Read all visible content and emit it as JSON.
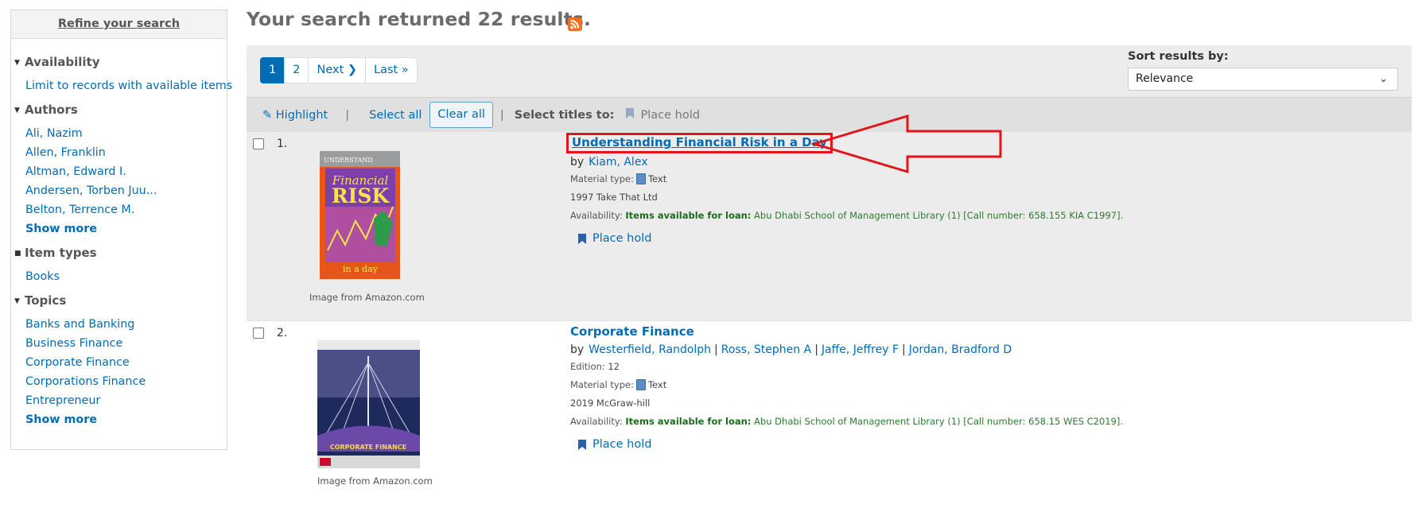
{
  "sidebar": {
    "refine_title": "Refine your search",
    "groups": [
      {
        "heading": "Availability",
        "caret": "down",
        "items": [
          "Limit to records with available items"
        ]
      },
      {
        "heading": "Authors",
        "caret": "down",
        "items": [
          "Ali, Nazim",
          "Allen, Franklin",
          "Altman, Edward I.",
          "Andersen, Torben Juu...",
          "Belton, Terrence M."
        ],
        "more": "Show more"
      },
      {
        "heading": "Item types",
        "caret": "square",
        "items": [
          "Books"
        ]
      },
      {
        "heading": "Topics",
        "caret": "down",
        "items": [
          "Banks and Banking",
          "Business Finance",
          "Corporate Finance",
          "Corporations Finance",
          "Entrepreneur"
        ],
        "more": "Show more"
      }
    ]
  },
  "header": {
    "title": "Your search returned 22 results.",
    "rss_icon": "rss-feed-icon"
  },
  "pagination": {
    "pages": [
      "1",
      "2"
    ],
    "active": "1",
    "next": "Next",
    "last": "Last"
  },
  "sort": {
    "label": "Sort results by:",
    "selected": "Relevance"
  },
  "toolbar": {
    "highlight": "Highlight",
    "select_all": "Select all",
    "clear_all": "Clear all",
    "select_titles": "Select titles to:",
    "place_hold": "Place hold"
  },
  "results": [
    {
      "number": "1.",
      "title": "Understanding Financial Risk in a Day",
      "by": "by",
      "authors": [
        "Kiam, Alex"
      ],
      "material_label": "Material type:",
      "material": "Text",
      "publication": "1997 Take That Ltd",
      "availability_label": "Availability:",
      "availability_status": "Items available for loan:",
      "availability_detail": " Abu Dhabi School of Management Library (1) [Call number: 658.155 KIA C1997].",
      "place_hold": "Place hold",
      "image_caption": "Image from Amazon.com",
      "cover_text": [
        "UNDERSTAND",
        "Financial",
        "RISK",
        "in a day"
      ]
    },
    {
      "number": "2.",
      "title": "Corporate Finance",
      "by": "by",
      "authors": [
        "Westerfield, Randolph",
        "Ross, Stephen A",
        "Jaffe, Jeffrey F",
        "Jordan, Bradford D"
      ],
      "edition_label": "Edition:",
      "edition": "12",
      "material_label": "Material type:",
      "material": "Text",
      "publication": "2019 McGraw-hill",
      "availability_label": "Availability:",
      "availability_status": "Items available for loan:",
      "availability_detail": " Abu Dhabi School of Management Library (1) [Call number: 658.15 WES C2019].",
      "place_hold": "Place hold",
      "image_caption": "Image from Amazon.com",
      "cover_text": [
        "CORPORATE FINANCE"
      ]
    }
  ],
  "colors": {
    "link": "#006cb4",
    "annotation": "#e2151b",
    "available": "#2d7a2d"
  }
}
